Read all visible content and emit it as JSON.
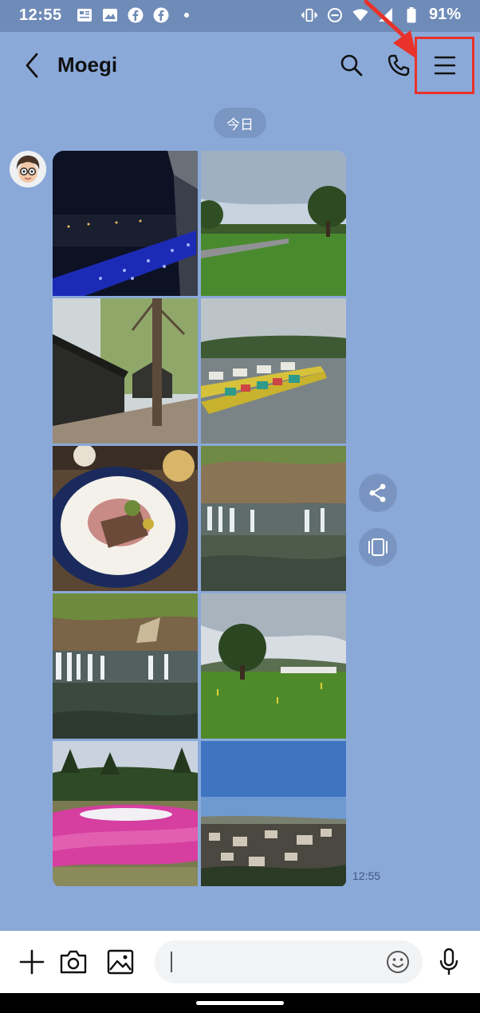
{
  "status_bar": {
    "time": "12:55",
    "battery": "91%",
    "icons": [
      "news-icon",
      "image-icon",
      "facebook-icon",
      "facebook-icon",
      "dot-icon",
      "vibrate-icon",
      "dnd-icon",
      "wifi-icon",
      "signal-icon",
      "battery-icon"
    ]
  },
  "header": {
    "title": "Moegi",
    "icons": [
      "back-icon",
      "search-icon",
      "phone-icon",
      "menu-icon"
    ],
    "highlight_color": "#e8322a"
  },
  "chat": {
    "date_separator": "今日",
    "message_time": "12:55",
    "photos": [
      "night-illumination-photo",
      "park-lawn-photo",
      "wooden-cottages-photo",
      "swan-boats-photo",
      "dinner-plate-photo",
      "waterfall-photo",
      "waterfall-pool-photo",
      "open-field-photo",
      "moss-phlox-garden-photo",
      "town-and-sea-photo"
    ],
    "side_actions": [
      "share-icon",
      "slideshow-icon"
    ]
  },
  "input_bar": {
    "icons": [
      "plus-icon",
      "camera-icon",
      "gallery-icon",
      "emoji-icon",
      "mic-icon"
    ],
    "message_value": "",
    "message_placeholder": ""
  },
  "colors": {
    "chat_background": "#8aa9d9",
    "status_bar": "#6f8bb8",
    "annotation": "#e8322a"
  }
}
